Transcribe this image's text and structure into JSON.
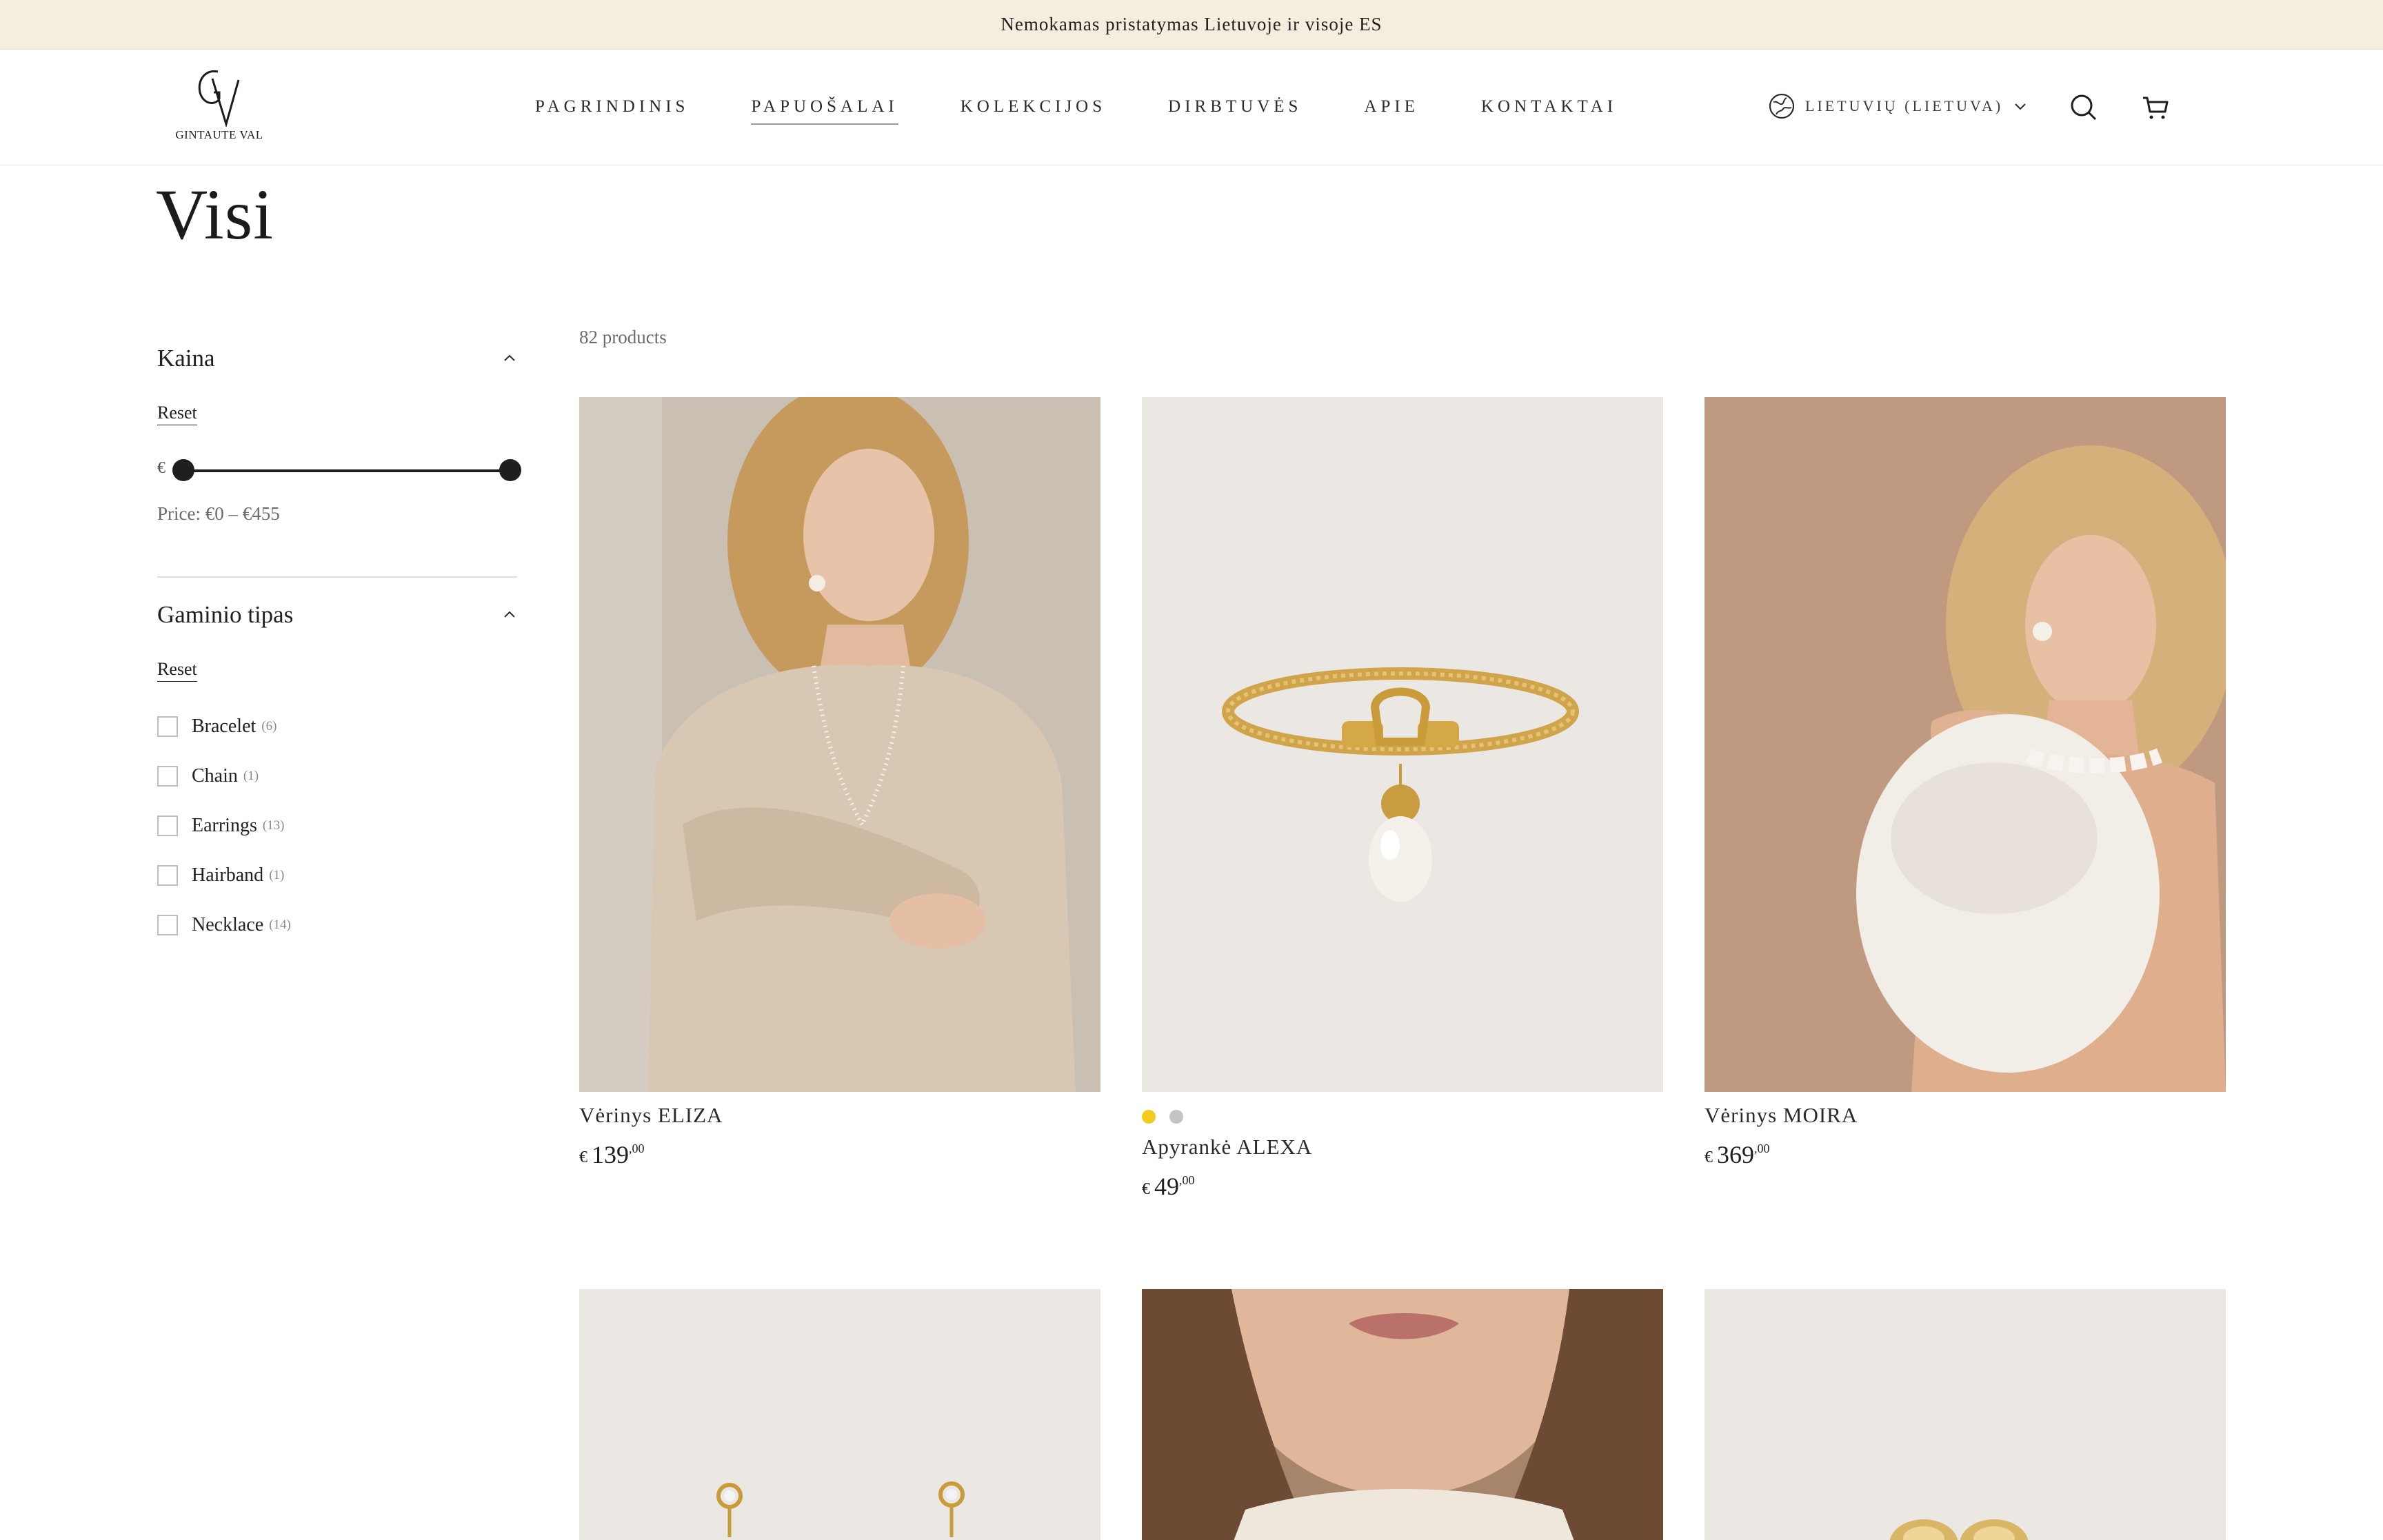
{
  "announcement": "Nemokamas pristatymas Lietuvoje ir visoje ES",
  "brand": {
    "logo_text": "GINTAUTE VAL"
  },
  "nav": [
    {
      "label": "PAGRINDINIS",
      "active": false
    },
    {
      "label": "PAPUOŠALAI",
      "active": true
    },
    {
      "label": "KOLEKCIJOS",
      "active": false
    },
    {
      "label": "DIRBTUVĖS",
      "active": false
    },
    {
      "label": "APIE",
      "active": false
    },
    {
      "label": "KONTAKTAI",
      "active": false
    }
  ],
  "header": {
    "locale_label": "LIETUVIŲ (LIETUVA)",
    "icons": [
      "globe-icon",
      "search-icon",
      "cart-icon"
    ]
  },
  "page": {
    "title": "Visi"
  },
  "filters": {
    "price": {
      "title": "Kaina",
      "reset_label": "Reset",
      "currency": "€",
      "range_text": "Price: €0 – €455",
      "min_fraction": 0,
      "max_fraction": 1
    },
    "type": {
      "title": "Gaminio tipas",
      "reset_label": "Reset",
      "options": [
        {
          "label": "Bracelet",
          "count": "(6)"
        },
        {
          "label": "Chain",
          "count": "(1)"
        },
        {
          "label": "Earrings",
          "count": "(13)"
        },
        {
          "label": "Hairband",
          "count": "(1)"
        },
        {
          "label": "Necklace",
          "count": "(14)"
        }
      ]
    }
  },
  "results": {
    "count_text": "82 products"
  },
  "products": [
    {
      "name": "Vėrinys ELIZA",
      "currency": "€",
      "price_whole": "139",
      "price_decimal": ",00",
      "swatches": []
    },
    {
      "name": "Apyrankė ALEXA",
      "currency": "€",
      "price_whole": "49",
      "price_decimal": ",00",
      "swatches": [
        "#f2cc1d",
        "#c4c4c4"
      ]
    },
    {
      "name": "Vėrinys MOIRA",
      "currency": "€",
      "price_whole": "369",
      "price_decimal": ",00",
      "swatches": []
    }
  ],
  "colors": {
    "announcement_bg": "#f5eddd",
    "accent_dark": "#1f1f1f",
    "swatch_gold": "#f2cc1d",
    "swatch_silver": "#c4c4c4"
  }
}
